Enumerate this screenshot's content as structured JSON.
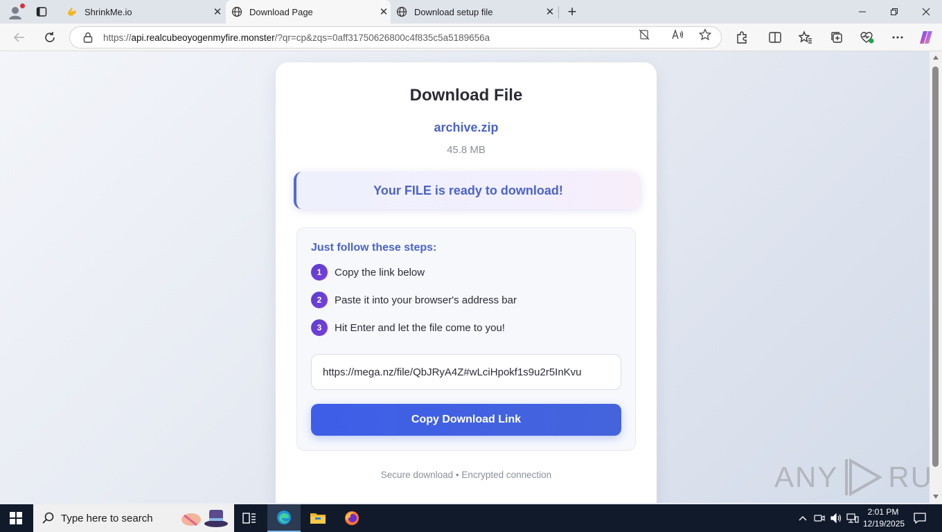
{
  "browser": {
    "tabs": [
      {
        "title": "ShrinkMe.io",
        "active": false
      },
      {
        "title": "Download Page",
        "active": true
      },
      {
        "title": "Download setup file",
        "active": false
      }
    ],
    "address": {
      "scheme": "https://",
      "host": "api.realcubeoyogenmyfire.monster",
      "path": "/?qr=cp&zqs=0aff31750626800c4f835c5a5189656a"
    }
  },
  "page": {
    "title": "Download File",
    "file_name": "archive.zip",
    "file_size": "45.8 MB",
    "ready_message": "Your FILE is ready to download!",
    "steps_heading": "Just follow these steps:",
    "steps": [
      {
        "num": "1",
        "text": "Copy the link below"
      },
      {
        "num": "2",
        "text": "Paste it into your browser's address bar"
      },
      {
        "num": "3",
        "text": "Hit Enter and let the file come to you!"
      }
    ],
    "link_value": "https://mega.nz/file/QbJRyA4Z#wLciHpokf1s9u2r5InKvu",
    "copy_button": "Copy Download Link",
    "secure_note": "Secure download • Encrypted connection"
  },
  "watermark": {
    "left": "ANY",
    "right": "RUN"
  },
  "taskbar": {
    "search_placeholder": "Type here to search",
    "time": "2:01 PM",
    "date": "12/19/2025"
  },
  "colors": {
    "accent": "#4a63c9",
    "button": "#3e5ee8",
    "step_badge": "#6a3fd4"
  }
}
